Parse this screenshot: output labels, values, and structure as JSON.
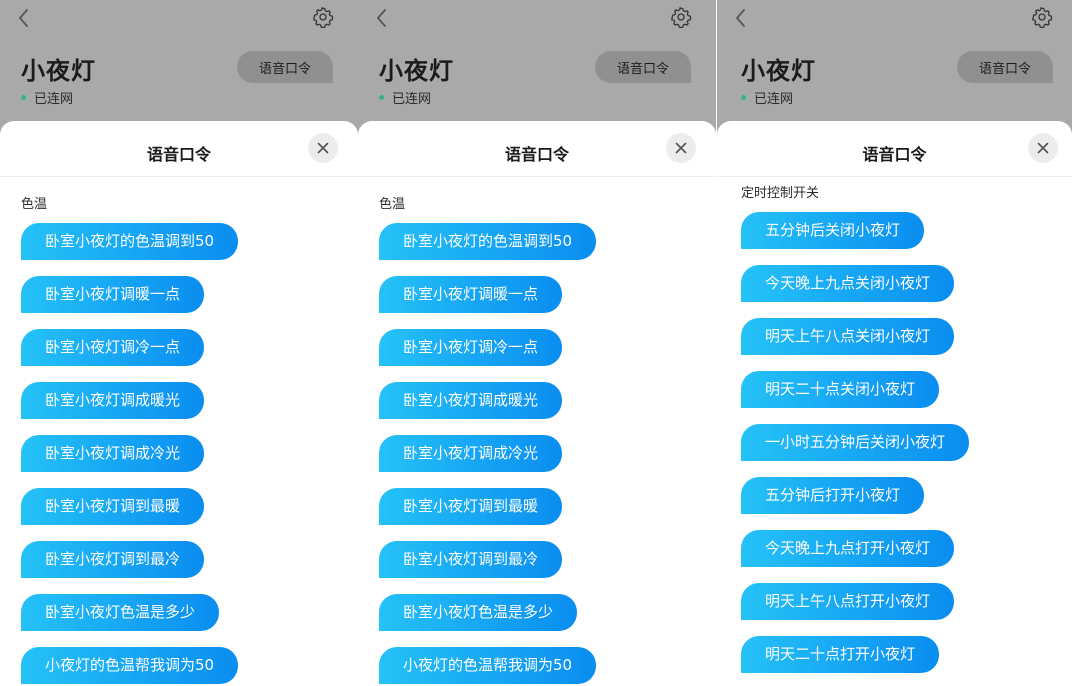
{
  "screens": [
    {
      "device_name": "小夜灯",
      "status": "已连网",
      "voice_button": "语音口令",
      "sheet_title": "语音口令",
      "section": "色温",
      "commands": [
        "卧室小夜灯的色温调到50",
        "卧室小夜灯调暖一点",
        "卧室小夜灯调冷一点",
        "卧室小夜灯调成暖光",
        "卧室小夜灯调成冷光",
        "卧室小夜灯调到最暖",
        "卧室小夜灯调到最冷",
        "卧室小夜灯色温是多少",
        "小夜灯的色温帮我调为50"
      ]
    },
    {
      "device_name": "小夜灯",
      "status": "已连网",
      "voice_button": "语音口令",
      "sheet_title": "语音口令",
      "section": "色温",
      "commands": [
        "卧室小夜灯的色温调到50",
        "卧室小夜灯调暖一点",
        "卧室小夜灯调冷一点",
        "卧室小夜灯调成暖光",
        "卧室小夜灯调成冷光",
        "卧室小夜灯调到最暖",
        "卧室小夜灯调到最冷",
        "卧室小夜灯色温是多少",
        "小夜灯的色温帮我调为50"
      ]
    },
    {
      "device_name": "小夜灯",
      "status": "已连网",
      "voice_button": "语音口令",
      "sheet_title": "语音口令",
      "section": "定时控制开关",
      "commands": [
        "五分钟后关闭小夜灯",
        "今天晚上九点关闭小夜灯",
        "明天上午八点关闭小夜灯",
        "明天二十点关闭小夜灯",
        "一小时五分钟后关闭小夜灯",
        "五分钟后打开小夜灯",
        "今天晚上九点打开小夜灯",
        "明天上午八点打开小夜灯",
        "明天二十点打开小夜灯"
      ]
    }
  ],
  "icons": {
    "back": "chevron-left-icon",
    "settings": "gear-icon",
    "close": "close-icon"
  },
  "colors": {
    "command_gradient_start": "#25c2f7",
    "command_gradient_end": "#0a8df0",
    "status_dot": "#36b37e",
    "dim_overlay": "#a9a9aa"
  }
}
